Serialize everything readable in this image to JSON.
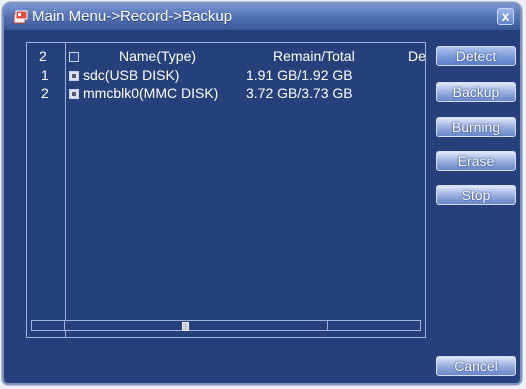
{
  "window": {
    "title": "Main Menu->Record->Backup",
    "close_glyph": "x"
  },
  "table": {
    "headers": {
      "index": "2",
      "name": "Name(Type)",
      "remain": "Remain/Total",
      "device": "De"
    },
    "rows": [
      {
        "index": "1",
        "checked": true,
        "name": "sdc(USB DISK)",
        "remain": "1.91 GB/1.92 GB"
      },
      {
        "index": "2",
        "checked": true,
        "name": "mmcblk0(MMC DISK)",
        "remain": "3.72 GB/3.73 GB"
      }
    ]
  },
  "buttons": {
    "detect": "Detect",
    "backup": "Backup",
    "burning": "Burning",
    "erase": "Erase",
    "stop": "Stop",
    "cancel": "Cancel"
  },
  "icons": {
    "title": "app-icon",
    "close": "close-icon"
  },
  "colors": {
    "window_bg": "#273f7b",
    "title_bar": "#5473b6",
    "border": "#9eb2dd",
    "button": "#7f9ddd",
    "text": "#ffffff"
  }
}
